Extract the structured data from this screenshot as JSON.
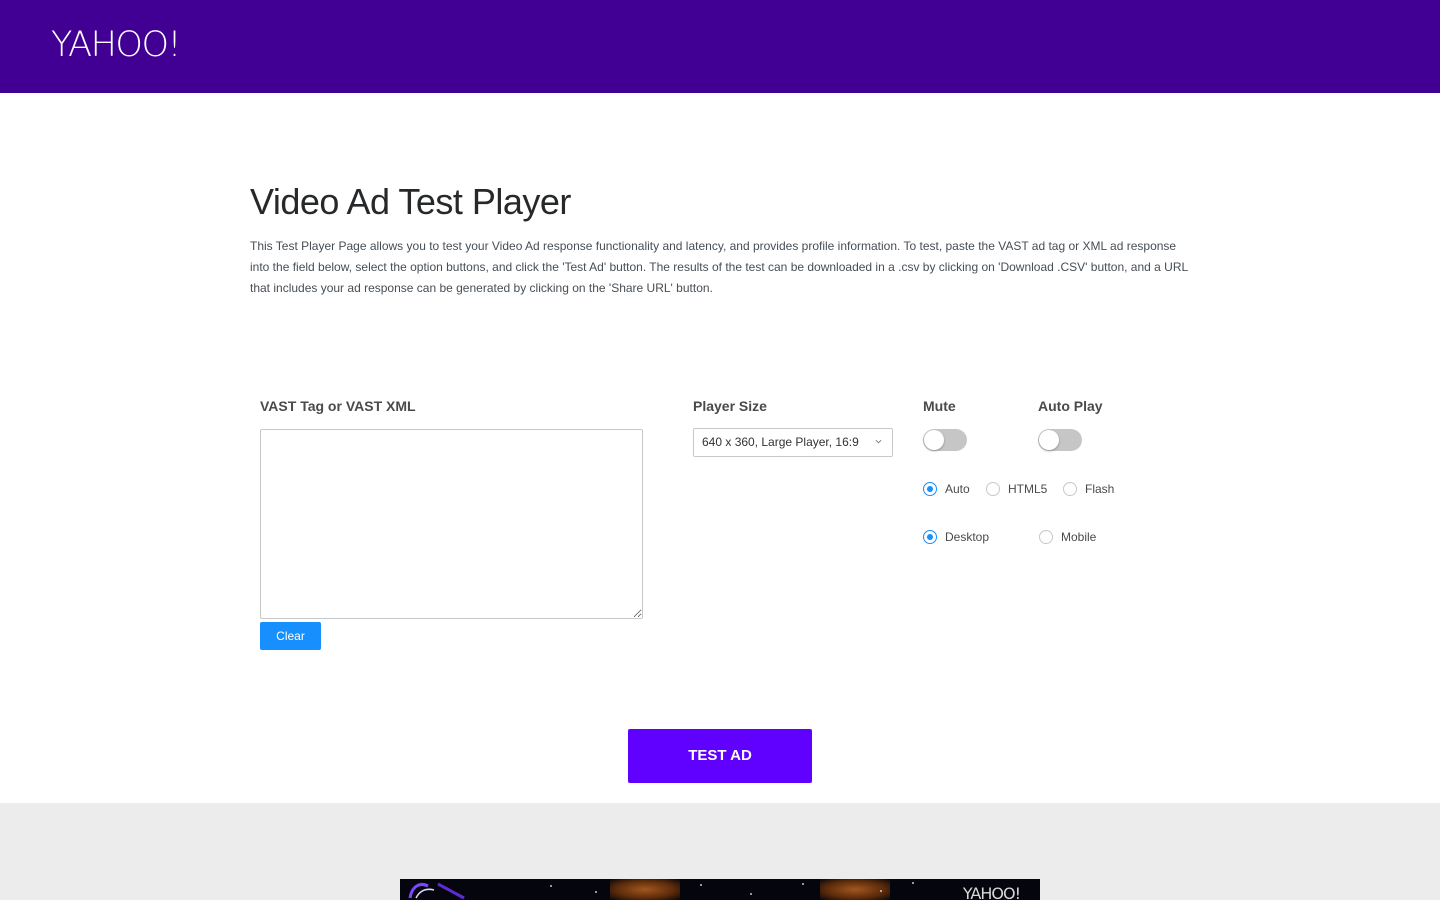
{
  "header": {
    "logo_text": "YAHOO!",
    "background_color": "#410093"
  },
  "intro": {
    "title": "Video Ad Test Player",
    "description": "This Test Player Page allows you to test your Video Ad response functionality and latency, and provides profile information. To test, paste the VAST ad tag or XML ad response into the field below, select the option buttons, and click the 'Test Ad' button. The results of the test can be downloaded in a .csv by clicking on 'Download .CSV' button, and a URL that includes your ad response can be generated by clicking on the 'Share URL' button."
  },
  "form": {
    "vast": {
      "label": "VAST Tag or VAST XML",
      "value": "",
      "clear_label": "Clear"
    },
    "player_size": {
      "label": "Player Size",
      "selected": "640 x 360, Large Player, 16:9"
    },
    "mute": {
      "label": "Mute",
      "on": false
    },
    "autoplay": {
      "label": "Auto Play",
      "on": false
    },
    "tech_options": [
      {
        "label": "Auto",
        "selected": true
      },
      {
        "label": "HTML5",
        "selected": false
      },
      {
        "label": "Flash",
        "selected": false
      }
    ],
    "device_options": [
      {
        "label": "Desktop",
        "selected": true
      },
      {
        "label": "Mobile",
        "selected": false
      }
    ]
  },
  "actions": {
    "test_ad_label": "TEST AD",
    "test_ad_color": "#6001ff",
    "clear_color": "#188fff"
  },
  "preview": {
    "logo_text": "YAHOO!"
  }
}
